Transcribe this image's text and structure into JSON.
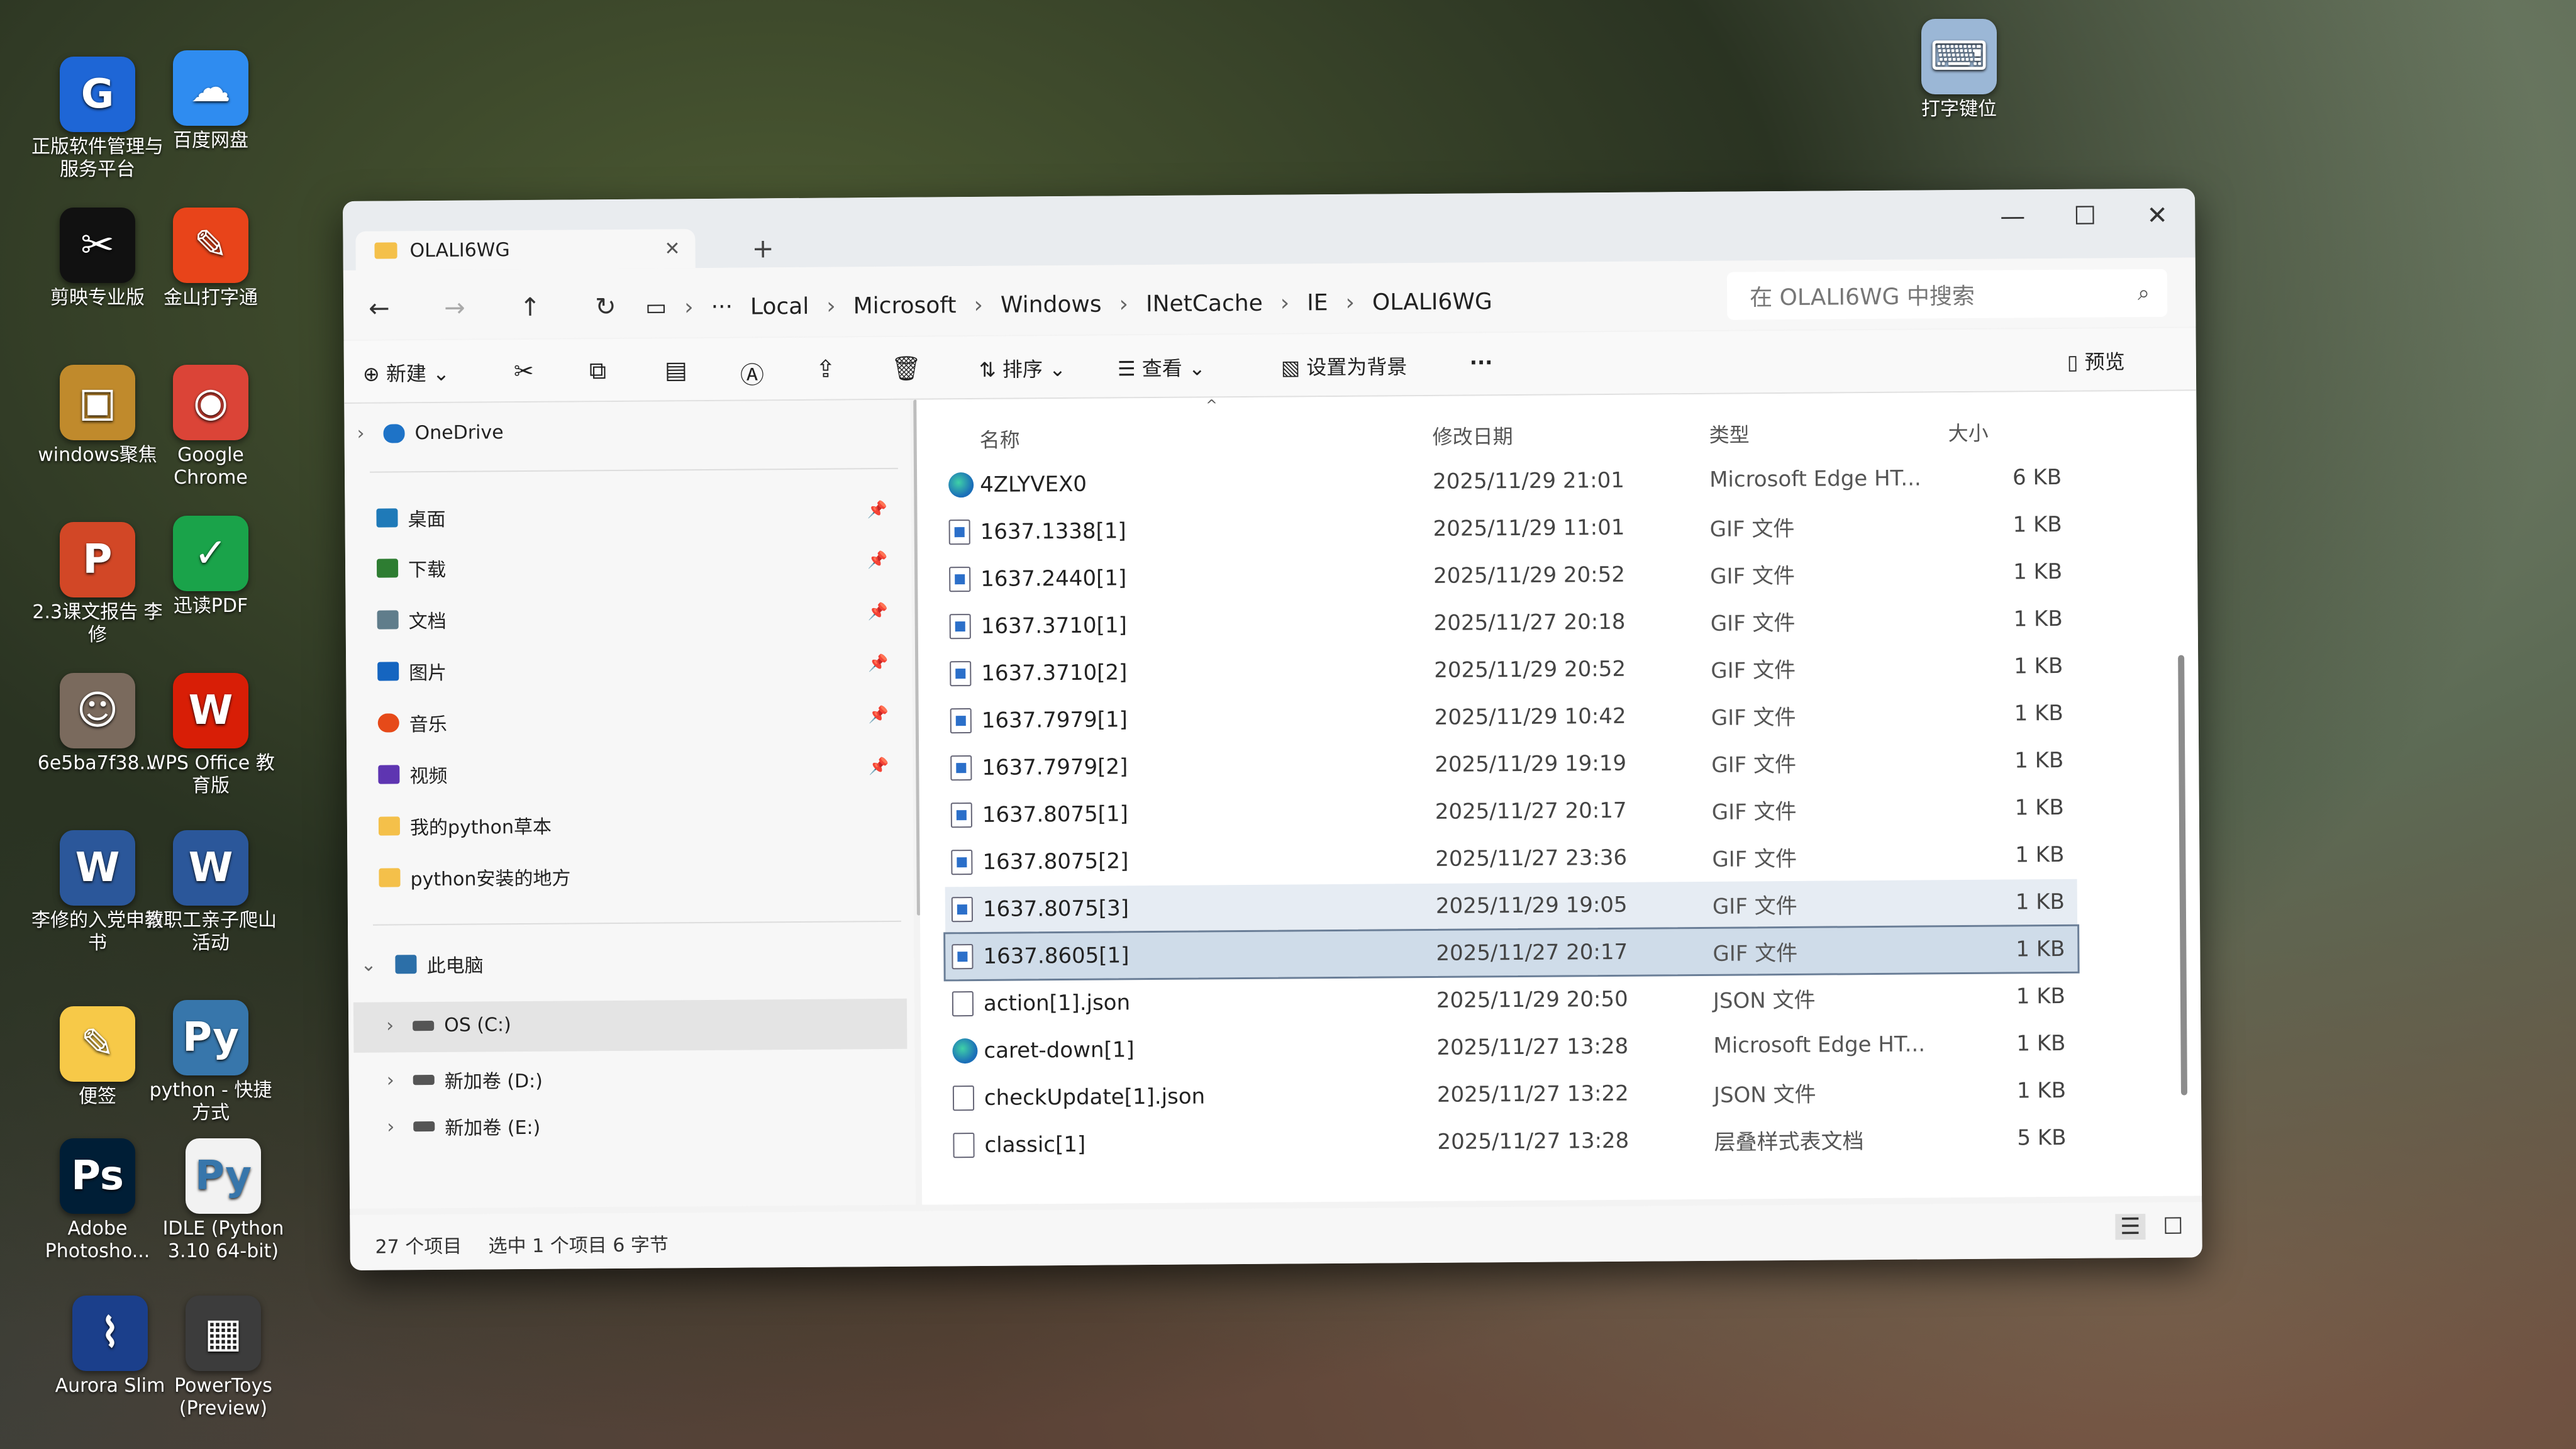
{
  "desktop": {
    "icons": [
      {
        "label": "正版软件管理与服务平台",
        "color": "#1e66d6",
        "glyph": "G"
      },
      {
        "label": "百度网盘",
        "color": "#2f8cf0",
        "glyph": "☁"
      },
      {
        "label": "剪映专业版",
        "color": "#111111",
        "glyph": "✂"
      },
      {
        "label": "金山打字通",
        "color": "#e8441a",
        "glyph": "✎"
      },
      {
        "label": "windows聚焦",
        "color": "#c08a2c",
        "glyph": "▣"
      },
      {
        "label": "Google Chrome",
        "color": "#db4437",
        "glyph": "◉"
      },
      {
        "label": "2.3课文报告 李修",
        "color": "#d24726",
        "glyph": "P"
      },
      {
        "label": "迅读PDF",
        "color": "#1aa34a",
        "glyph": "✓"
      },
      {
        "label": "6e5ba7f38...",
        "color": "#7a6a5d",
        "glyph": "☺"
      },
      {
        "label": "WPS Office 教育版",
        "color": "#d81e06",
        "glyph": "W"
      },
      {
        "label": "李修的入党申请书",
        "color": "#2b579a",
        "glyph": "W"
      },
      {
        "label": "教职工亲子爬山活动",
        "color": "#2b579a",
        "glyph": "W"
      },
      {
        "label": "便签",
        "color": "#f7c948",
        "glyph": "✎"
      },
      {
        "label": "python - 快捷方式",
        "color": "#3776ab",
        "glyph": "Py"
      },
      {
        "label": "Adobe Photosho...",
        "color": "#001e36",
        "glyph": "Ps"
      },
      {
        "label": "IDLE (Python 3.10 64-bit)",
        "color": "#f2f2f2",
        "glyph": "Py"
      },
      {
        "label": "Aurora Slim",
        "color": "#1b3f8b",
        "glyph": "⌇"
      },
      {
        "label": "PowerToys (Preview)",
        "color": "#3c3c3c",
        "glyph": "▦"
      },
      {
        "label": "打字键位",
        "color": "#9bb7d6",
        "glyph": "⌨"
      }
    ]
  },
  "window": {
    "tab_title": "OLALI6WG",
    "breadcrumbs": [
      "···",
      "Local",
      "Microsoft",
      "Windows",
      "INetCache",
      "IE",
      "OLALI6WG"
    ],
    "search_placeholder": "在 OLALI6WG 中搜索",
    "commands": {
      "new": "新建",
      "sort": "排序",
      "view": "查看",
      "set_bg": "设置为背景",
      "more": "···",
      "preview": "预览"
    },
    "sidebar": {
      "onedrive": "OneDrive",
      "quick": [
        {
          "label": "桌面",
          "color": "#1f7ab8"
        },
        {
          "label": "下载",
          "color": "#2e7d32"
        },
        {
          "label": "文档",
          "color": "#607d8b"
        },
        {
          "label": "图片",
          "color": "#1565c0"
        },
        {
          "label": "音乐",
          "color": "#e64a19"
        },
        {
          "label": "视频",
          "color": "#5e35b1"
        },
        {
          "label": "我的python草本",
          "color": "#f4c04a"
        },
        {
          "label": "python安装的地方",
          "color": "#f4c04a"
        }
      ],
      "this_pc": "此电脑",
      "drives": [
        "OS (C:)",
        "新加卷 (D:)",
        "新加卷 (E:)"
      ]
    },
    "columns": {
      "name": "名称",
      "date": "修改日期",
      "type": "类型",
      "size": "大小"
    },
    "files": [
      {
        "name": "4ZLYVEX0",
        "date": "2025/11/29 21:01",
        "type": "Microsoft Edge HT...",
        "size": "6 KB",
        "icon": "edge"
      },
      {
        "name": "1637.1338[1]",
        "date": "2025/11/29 11:01",
        "type": "GIF 文件",
        "size": "1 KB",
        "icon": "gif"
      },
      {
        "name": "1637.2440[1]",
        "date": "2025/11/29 20:52",
        "type": "GIF 文件",
        "size": "1 KB",
        "icon": "gif"
      },
      {
        "name": "1637.3710[1]",
        "date": "2025/11/27 20:18",
        "type": "GIF 文件",
        "size": "1 KB",
        "icon": "gif"
      },
      {
        "name": "1637.3710[2]",
        "date": "2025/11/29 20:52",
        "type": "GIF 文件",
        "size": "1 KB",
        "icon": "gif"
      },
      {
        "name": "1637.7979[1]",
        "date": "2025/11/29 10:42",
        "type": "GIF 文件",
        "size": "1 KB",
        "icon": "gif"
      },
      {
        "name": "1637.7979[2]",
        "date": "2025/11/29 19:19",
        "type": "GIF 文件",
        "size": "1 KB",
        "icon": "gif"
      },
      {
        "name": "1637.8075[1]",
        "date": "2025/11/27 20:17",
        "type": "GIF 文件",
        "size": "1 KB",
        "icon": "gif"
      },
      {
        "name": "1637.8075[2]",
        "date": "2025/11/27 23:36",
        "type": "GIF 文件",
        "size": "1 KB",
        "icon": "gif"
      },
      {
        "name": "1637.8075[3]",
        "date": "2025/11/29 19:05",
        "type": "GIF 文件",
        "size": "1 KB",
        "icon": "gif"
      },
      {
        "name": "1637.8605[1]",
        "date": "2025/11/27 20:17",
        "type": "GIF 文件",
        "size": "1 KB",
        "icon": "gif"
      },
      {
        "name": "action[1].json",
        "date": "2025/11/29 20:50",
        "type": "JSON 文件",
        "size": "1 KB",
        "icon": "file"
      },
      {
        "name": "caret-down[1]",
        "date": "2025/11/27 13:28",
        "type": "Microsoft Edge HT...",
        "size": "1 KB",
        "icon": "edge"
      },
      {
        "name": "checkUpdate[1].json",
        "date": "2025/11/27 13:22",
        "type": "JSON 文件",
        "size": "1 KB",
        "icon": "file"
      },
      {
        "name": "classic[1]",
        "date": "2025/11/27 13:28",
        "type": "层叠样式表文档",
        "size": "5 KB",
        "icon": "file"
      }
    ],
    "status": {
      "count": "27 个项目",
      "selection": "选中 1 个项目 6 字节"
    }
  }
}
